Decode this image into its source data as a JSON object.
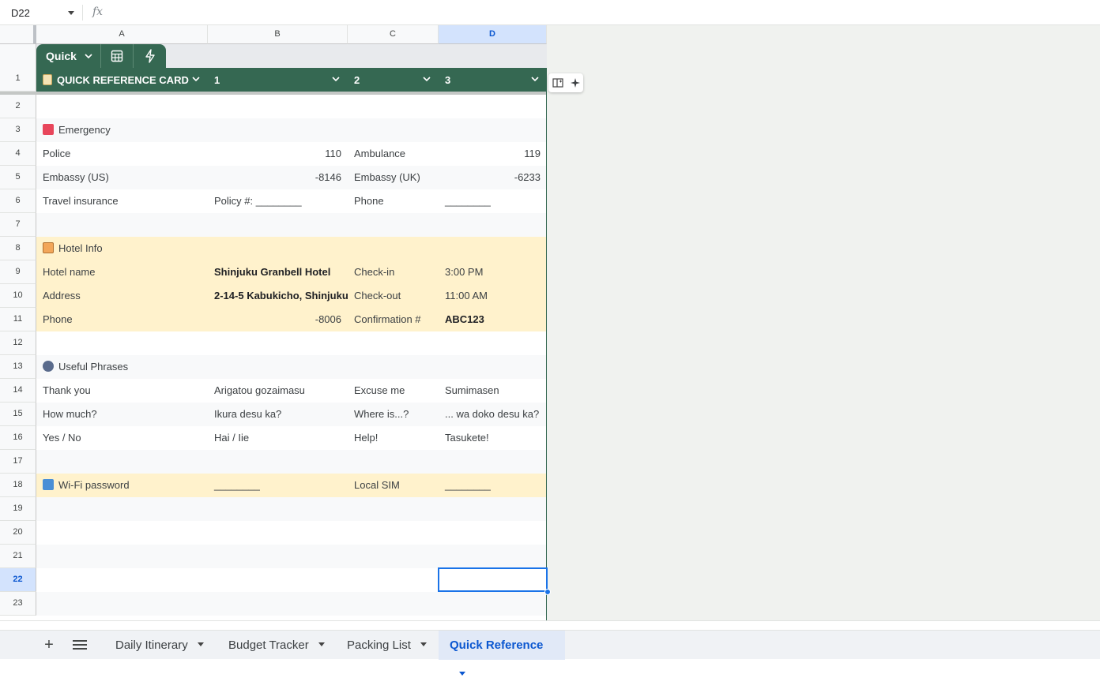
{
  "formula_bar": {
    "name_box": "D22",
    "fx_label": "fx"
  },
  "columns": [
    "A",
    "B",
    "C",
    "D"
  ],
  "selected_column": "D",
  "rows": [
    "1",
    "2",
    "3",
    "4",
    "5",
    "6",
    "7",
    "8",
    "9",
    "10",
    "11",
    "12",
    "13",
    "14",
    "15",
    "16",
    "17",
    "18",
    "19",
    "20",
    "21",
    "22",
    "23"
  ],
  "selected_row": "22",
  "table_toolbar": {
    "quick_label": "Quick"
  },
  "table_header": {
    "a": "QUICK REFERENCE CARD",
    "b": "1",
    "c": "2",
    "d": "3"
  },
  "emergency": {
    "title": "Emergency",
    "police_label": "Police",
    "police_value": "110",
    "ambulance_label": "Ambulance",
    "ambulance_value": "119",
    "embassy_us_label": "Embassy (US)",
    "embassy_us_value": "-8146",
    "embassy_uk_label": "Embassy (UK)",
    "embassy_uk_value": "-6233",
    "insurance_label": "Travel insurance",
    "policy_label": "Policy #: ________",
    "phone_label": "Phone",
    "phone_value": "________"
  },
  "hotel": {
    "title": "Hotel Info",
    "name_label": "Hotel name",
    "name_value": "Shinjuku Granbell Hotel",
    "checkin_label": "Check-in",
    "checkin_value": "3:00 PM",
    "address_label": "Address",
    "address_value": "2-14-5 Kabukicho, Shinjuku",
    "checkout_label": "Check-out",
    "checkout_value": "11:00 AM",
    "phone_label": "Phone",
    "phone_value": "-8006",
    "confirmation_label": "Confirmation #",
    "confirmation_value": "ABC123"
  },
  "phrases": {
    "title": "Useful Phrases",
    "r1": [
      "Thank you",
      "Arigatou gozaimasu",
      "Excuse me",
      "Sumimasen"
    ],
    "r2": [
      "How much?",
      "Ikura desu ka?",
      "Where is...?",
      "... wa doko desu ka?"
    ],
    "r3": [
      "Yes / No",
      "Hai / Iie",
      "Help!",
      "Tasukete!"
    ]
  },
  "wifi": {
    "title": "Wi-Fi password",
    "wifi_value": "________",
    "sim_label": "Local SIM",
    "sim_value": "________"
  },
  "sheet_tabs": [
    {
      "label": "Daily Itinerary"
    },
    {
      "label": "Budget Tracker"
    },
    {
      "label": "Packing List"
    },
    {
      "label": "Quick Reference"
    }
  ],
  "colors": {
    "table_green": "#356852",
    "band_yellow": "#fff2cc",
    "selection_blue": "#1a73e8"
  },
  "icons": {
    "emergency": "sos-icon",
    "hotel": "hotel-icon",
    "phrases": "speaking-head-icon",
    "wifi": "signal-bars-icon"
  }
}
